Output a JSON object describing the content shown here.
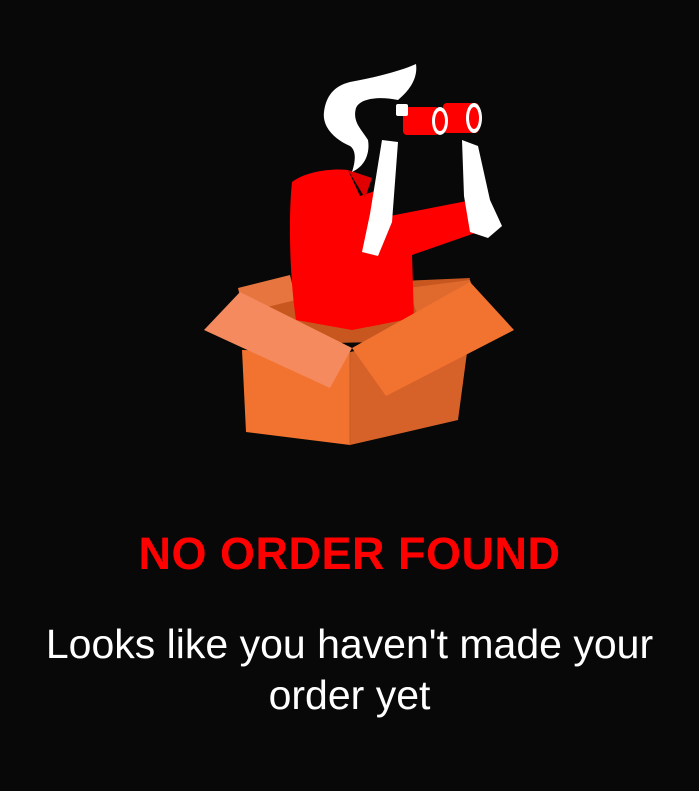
{
  "empty_state": {
    "illustration_icon": "person-in-box-with-binoculars-icon",
    "title": "NO ORDER FOUND",
    "message": "Looks like you haven't made your order yet"
  },
  "colors": {
    "background": "#080808",
    "accent": "#ff0000",
    "text": "#ffffff",
    "box_light": "#f58a5e",
    "box_mid": "#f27230",
    "box_dark": "#d6622a"
  }
}
